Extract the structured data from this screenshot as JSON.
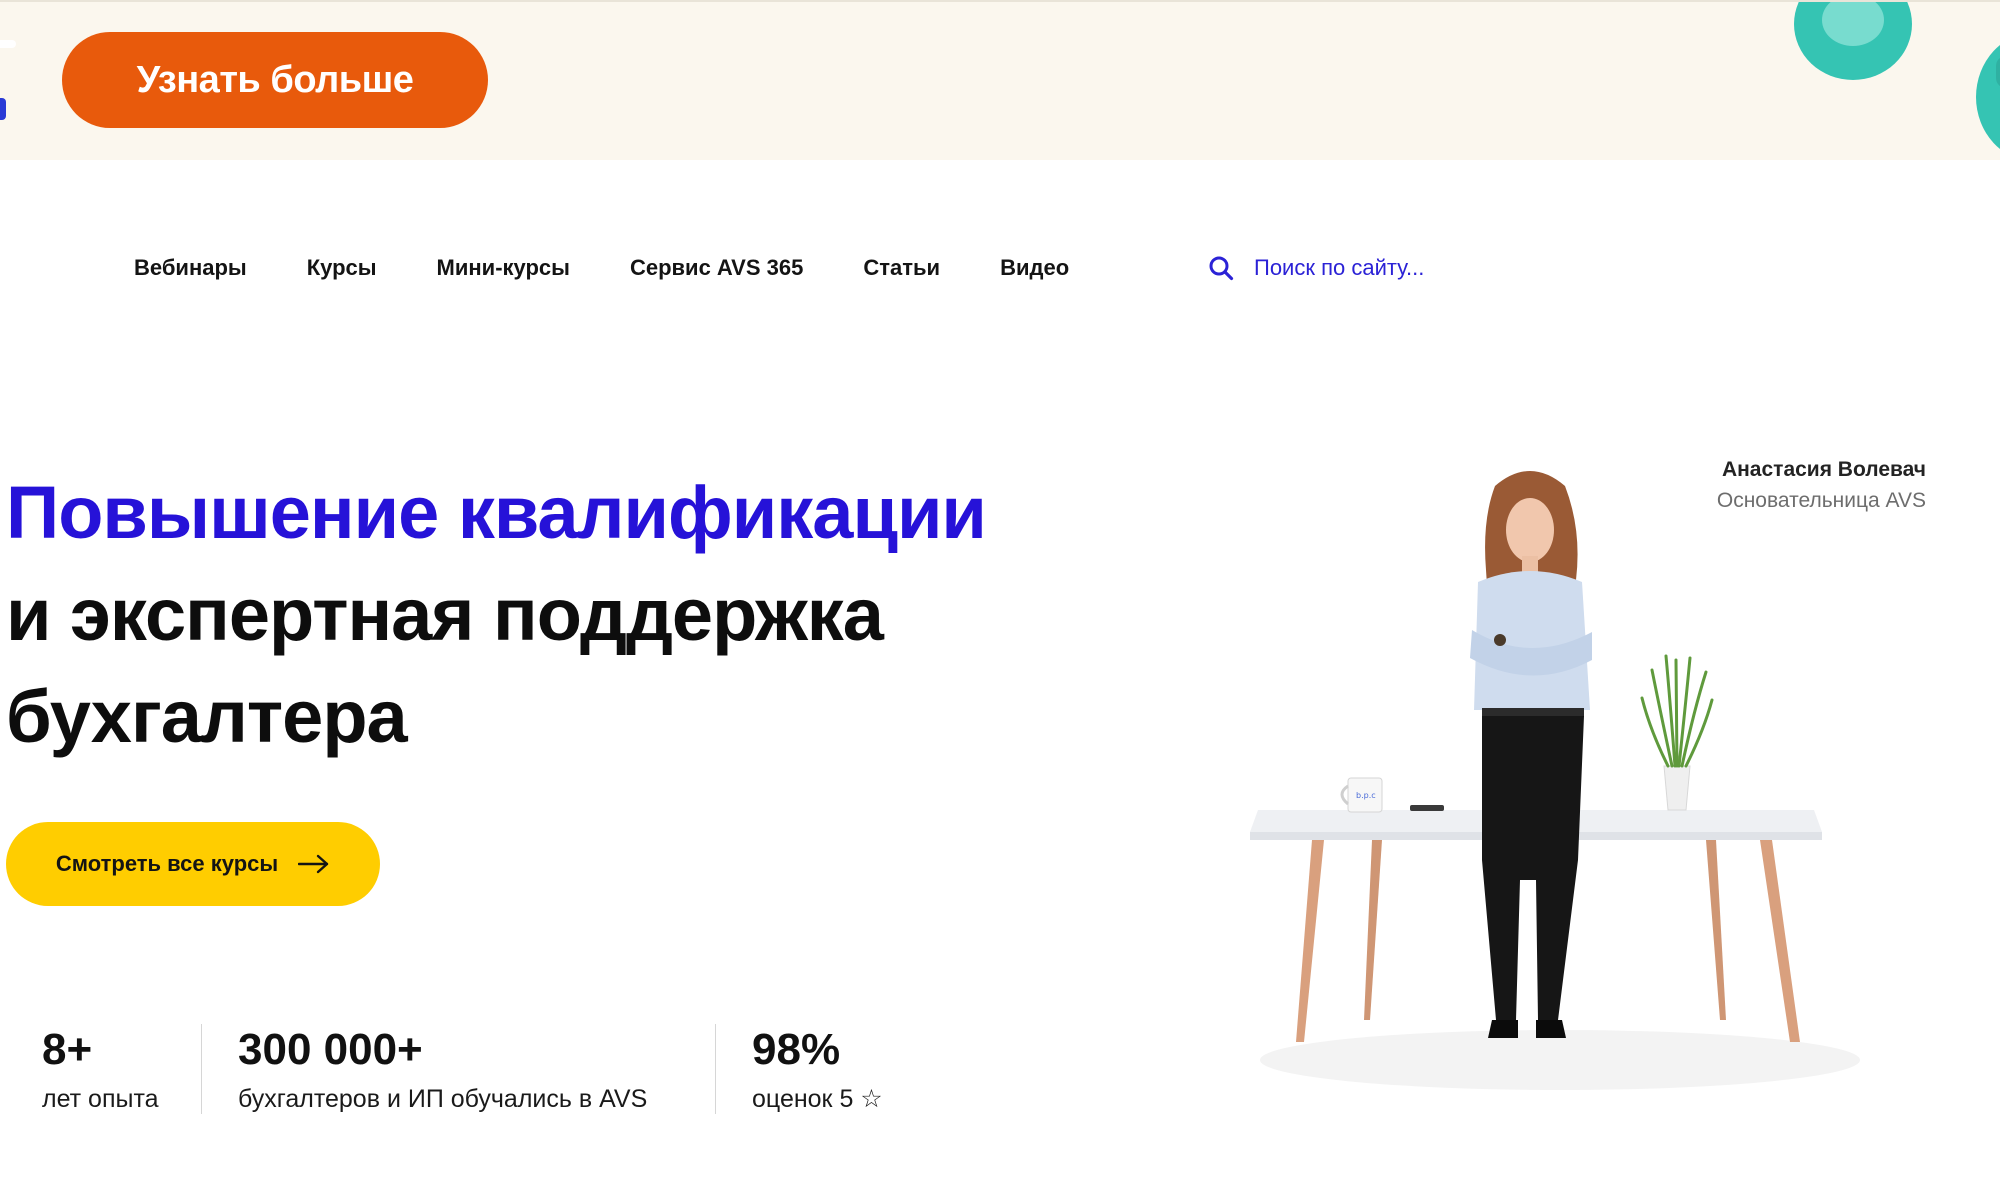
{
  "banner": {
    "cta_label": "Узнать больше",
    "background": "#fbf7ee",
    "cta_color": "#e85a0c",
    "decor": "teal-bubbles"
  },
  "nav": {
    "items": [
      "Вебинары",
      "Курсы",
      "Мини-курсы",
      "Сервис AVS 365",
      "Статьи",
      "Видео"
    ]
  },
  "search": {
    "placeholder": "Поиск по сайту...",
    "icon": "search-icon",
    "color": "#2b22d6"
  },
  "hero": {
    "title_accent": "Повышение квалификации",
    "title_line2": "и экспертная поддержка",
    "title_line3": "бухгалтера",
    "accent_color": "#2612d8",
    "cta_label": "Смотреть все курсы",
    "cta_color": "#ffcd00",
    "cta_icon": "arrow-right-icon"
  },
  "stats": [
    {
      "value": "8+",
      "label": "лет опыта"
    },
    {
      "value": "300 000+",
      "label": "бухгалтеров и ИП обучались в AVS"
    },
    {
      "value": "98%",
      "label": "оценок 5 ☆"
    }
  ],
  "founder": {
    "name": "Анастасия Волевач",
    "role": "Основательница AVS"
  }
}
